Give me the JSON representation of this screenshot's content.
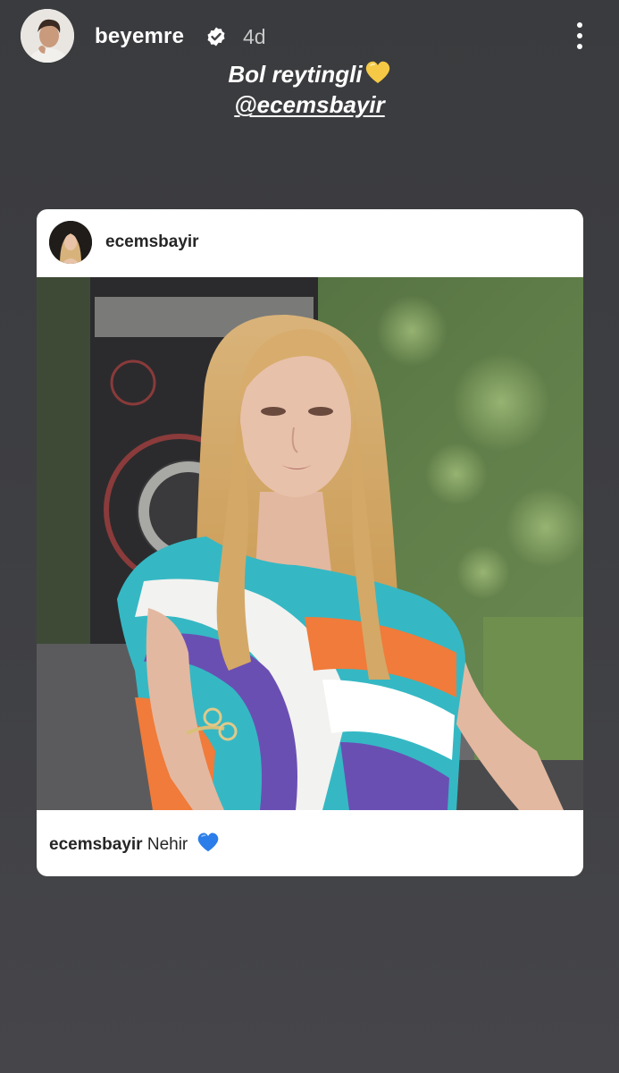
{
  "story": {
    "username": "beyemre",
    "time": "4d",
    "verified": true,
    "more_icon": "more-vertical-icon"
  },
  "caption": {
    "line1": "Bol reytingli",
    "emoji": "yellow-heart-icon",
    "mention": "@ecemsbayir"
  },
  "shared_post": {
    "username": "ecemsbayir",
    "caption_user": "ecemsbayir",
    "caption_text": "Nehir",
    "caption_emoji": "blue-heart-icon"
  },
  "colors": {
    "background": "#3e3f43",
    "card": "#ffffff",
    "verified_badge": "#ffffff",
    "yellow_heart": "#f5c945",
    "blue_heart": "#2b7de9"
  }
}
